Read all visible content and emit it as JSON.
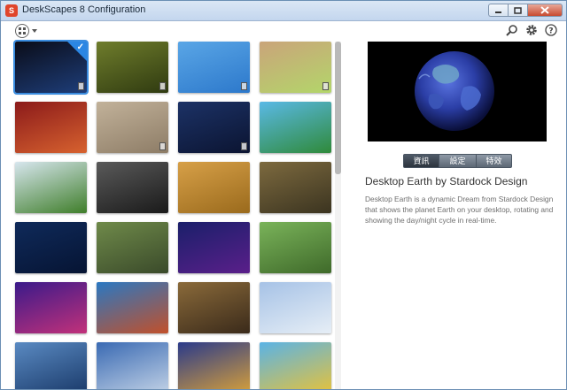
{
  "window": {
    "title": "DeskScapes 8 Configuration",
    "app_icon": "S"
  },
  "toolbar": {
    "view_icon": "grid-view-icon",
    "icons": [
      "search-icon",
      "gear-icon",
      "help-icon"
    ]
  },
  "detail": {
    "title": "Desktop Earth by Stardock Design",
    "description": "Desktop Earth is a dynamic Dream from Stardock Design that shows the planet Earth on your desktop, rotating and showing the day/night cycle in real-time.",
    "tabs": [
      {
        "label": "資訊",
        "active": true
      },
      {
        "label": "設定",
        "active": false
      },
      {
        "label": "特效",
        "active": false
      }
    ]
  },
  "thumbnails": [
    {
      "name": "earth",
      "colors": [
        "#0a0c18",
        "#1e3e7a"
      ],
      "selected": true,
      "badge": true
    },
    {
      "name": "grass",
      "colors": [
        "#6f7d2c",
        "#2f3a10"
      ],
      "selected": false,
      "badge": true
    },
    {
      "name": "blue-abstract",
      "colors": [
        "#5aa6e6",
        "#2c78cb"
      ],
      "selected": false,
      "badge": true
    },
    {
      "name": "tree-trunk",
      "colors": [
        "#caa47a",
        "#b3d66a"
      ],
      "selected": false,
      "badge": true
    },
    {
      "name": "diner",
      "colors": [
        "#8b1a1a",
        "#d7622f"
      ],
      "selected": false,
      "badge": false
    },
    {
      "name": "sand-ripples",
      "colors": [
        "#c2b29a",
        "#8d7c66"
      ],
      "selected": false,
      "badge": true
    },
    {
      "name": "stars-snow",
      "colors": [
        "#1c3266",
        "#0b1431"
      ],
      "selected": false,
      "badge": true
    },
    {
      "name": "floating-island",
      "colors": [
        "#5ab9e6",
        "#2f8a3a"
      ],
      "selected": false,
      "badge": false
    },
    {
      "name": "golf-ball",
      "colors": [
        "#d7e6ee",
        "#3f7e2a"
      ],
      "selected": false,
      "badge": false
    },
    {
      "name": "chess-knight",
      "colors": [
        "#5a5a5a",
        "#1a1a1a"
      ],
      "selected": false,
      "badge": false
    },
    {
      "name": "wheat",
      "colors": [
        "#d7a048",
        "#9a6a1c"
      ],
      "selected": false,
      "badge": false
    },
    {
      "name": "nest",
      "colors": [
        "#7d6a3f",
        "#3b3420"
      ],
      "selected": false,
      "badge": false
    },
    {
      "name": "planets",
      "colors": [
        "#0f2a5a",
        "#061433"
      ],
      "selected": false,
      "badge": false
    },
    {
      "name": "road-trees",
      "colors": [
        "#6f8a4a",
        "#3a4a2a"
      ],
      "selected": false,
      "badge": false
    },
    {
      "name": "aurora",
      "colors": [
        "#1a1f6a",
        "#5a1f8a"
      ],
      "selected": false,
      "badge": false
    },
    {
      "name": "pink-flower",
      "colors": [
        "#7ab35a",
        "#3f6a2a"
      ],
      "selected": false,
      "badge": false
    },
    {
      "name": "sound-wave",
      "colors": [
        "#3a1a8a",
        "#c2317a"
      ],
      "selected": false,
      "badge": false
    },
    {
      "name": "space-needle",
      "colors": [
        "#2a78c2",
        "#c2502a"
      ],
      "selected": false,
      "badge": false
    },
    {
      "name": "gold-curves",
      "colors": [
        "#8a6a3a",
        "#3a2a1a"
      ],
      "selected": false,
      "badge": false
    },
    {
      "name": "white-building",
      "colors": [
        "#a6c2e6",
        "#e6eef6"
      ],
      "selected": false,
      "badge": false
    },
    {
      "name": "blue-architecture",
      "colors": [
        "#5a8ac2",
        "#1a3a6a"
      ],
      "selected": false,
      "badge": false
    },
    {
      "name": "sphere-building",
      "colors": [
        "#3a6ab3",
        "#c2d2e6"
      ],
      "selected": false,
      "badge": false
    },
    {
      "name": "arches",
      "colors": [
        "#2a3a8a",
        "#d7a03a"
      ],
      "selected": false,
      "badge": false
    },
    {
      "name": "colorful-city",
      "colors": [
        "#5ab3e6",
        "#e6c23a"
      ],
      "selected": false,
      "badge": false
    }
  ]
}
